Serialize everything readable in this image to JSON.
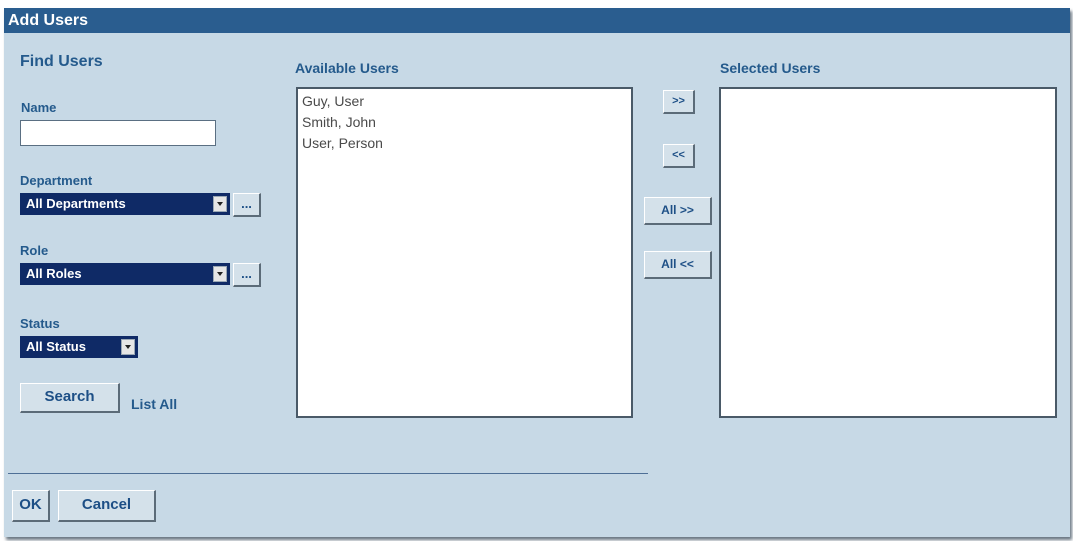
{
  "title": "Add Users",
  "find": {
    "heading": "Find Users",
    "name_label": "Name",
    "name_value": "",
    "department_label": "Department",
    "department_value": "All Departments",
    "department_lookup": "...",
    "role_label": "Role",
    "role_value": "All Roles",
    "role_lookup": "...",
    "status_label": "Status",
    "status_value": "All Status",
    "search_button": "Search",
    "list_all": "List All"
  },
  "available": {
    "heading": "Available Users",
    "items": [
      "Guy, User",
      "Smith, John",
      "User, Person"
    ]
  },
  "transfer": {
    "add": ">>",
    "remove": "<<",
    "add_all": "All >>",
    "remove_all": "All <<"
  },
  "selected": {
    "heading": "Selected Users",
    "items": []
  },
  "footer": {
    "ok": "OK",
    "cancel": "Cancel"
  },
  "colors": {
    "titlebar": "#2a5d8f",
    "panel": "#c7d9e6",
    "select_bg": "#0f2a66",
    "label": "#245a8c"
  }
}
